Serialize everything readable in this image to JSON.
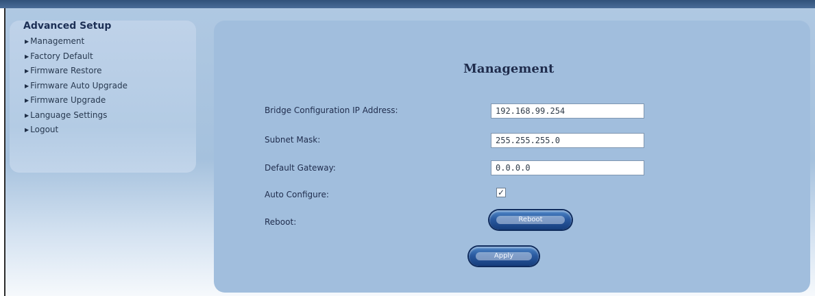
{
  "sidebar": {
    "title": "Advanced Setup",
    "items": [
      {
        "label": "Management"
      },
      {
        "label": "Factory Default"
      },
      {
        "label": "Firmware Restore"
      },
      {
        "label": "Firmware Auto Upgrade"
      },
      {
        "label": "Firmware Upgrade"
      },
      {
        "label": "Language Settings"
      },
      {
        "label": "Logout"
      }
    ]
  },
  "main": {
    "title": "Management",
    "fields": {
      "bridge_ip": {
        "label": "Bridge Configuration IP Address:",
        "value": "192.168.99.254"
      },
      "subnet_mask": {
        "label": "Subnet Mask:",
        "value": "255.255.255.0"
      },
      "default_gateway": {
        "label": "Default Gateway:",
        "value": "0.0.0.0"
      },
      "auto_configure": {
        "label": "Auto Configure:",
        "checked": true
      },
      "reboot": {
        "label": "Reboot:",
        "button_label": "Reboot"
      }
    },
    "apply_button": "Apply"
  },
  "colors": {
    "top_bar": "#31527a",
    "panel_blue": "#a1bedd",
    "sidebar_blue": "#b3cbe4",
    "button_blue": "#2a5aa0"
  },
  "icons": {
    "menu_bullet": "triangle-right",
    "checkbox_mark": "check"
  }
}
